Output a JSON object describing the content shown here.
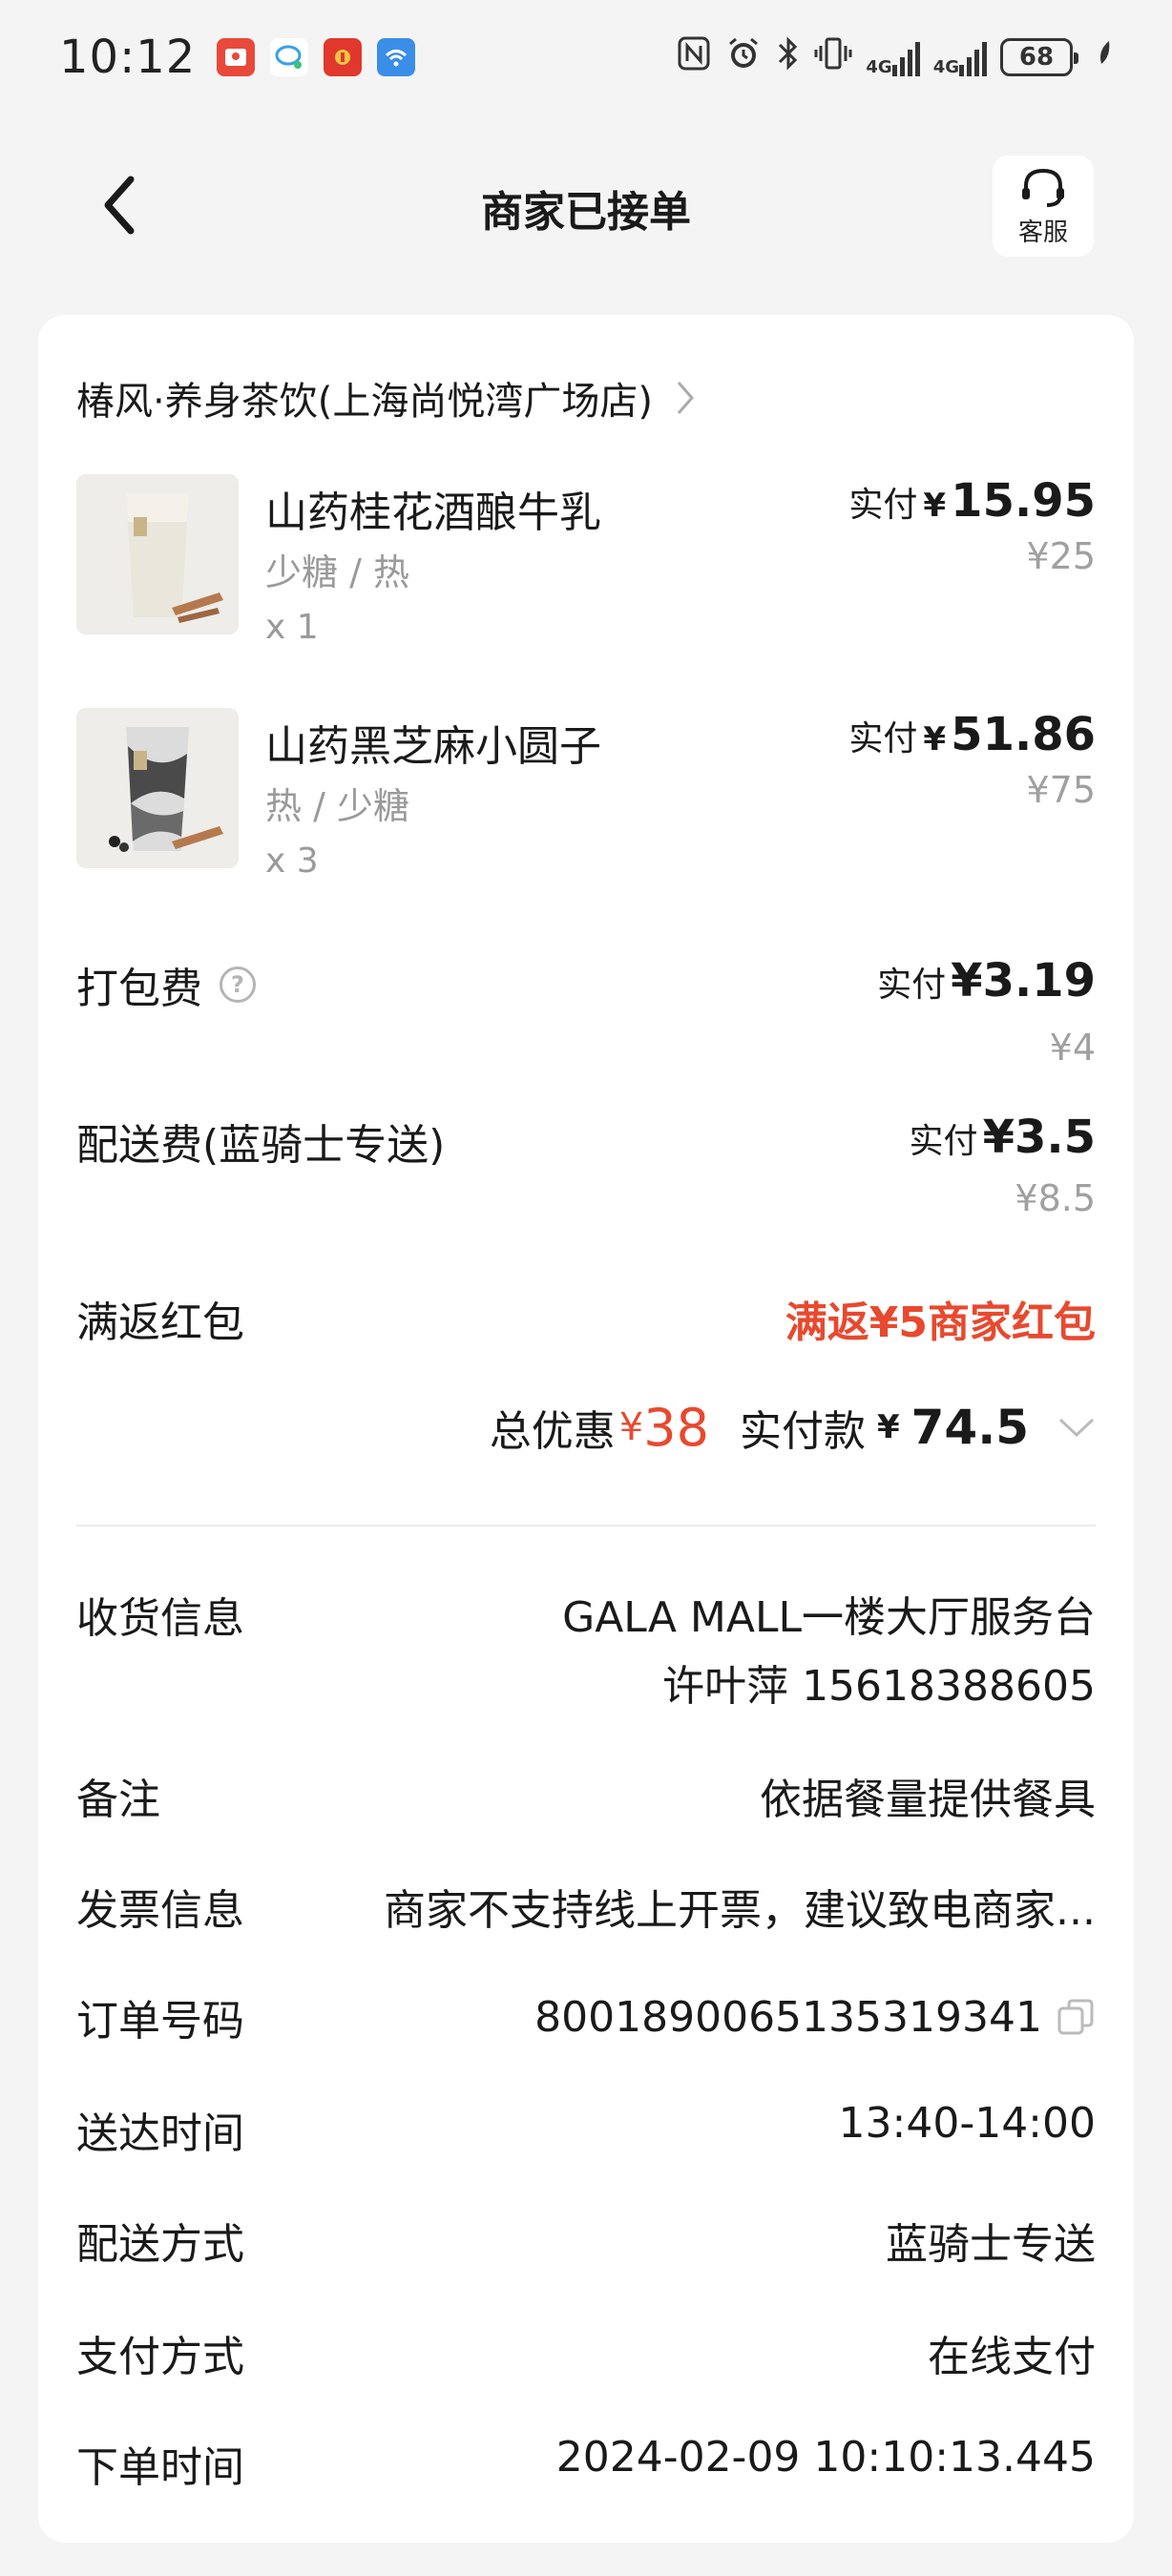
{
  "status_bar": {
    "time": "10:12",
    "network_1": "4G",
    "network_2": "4G",
    "battery": "68"
  },
  "header": {
    "title": "商家已接单",
    "service_label": "客服"
  },
  "store": {
    "name": "椿风·养身茶饮(上海尚悦湾广场店)"
  },
  "items": [
    {
      "name": "山药桂花酒酿牛乳",
      "spec": "少糖 / 热",
      "qty": "x 1",
      "paid_label": "实付",
      "paid_yen": "¥",
      "paid_value": "15.95",
      "original_price": "¥25"
    },
    {
      "name": "山药黑芝麻小圆子",
      "spec": "热 / 少糖",
      "qty": "x 3",
      "paid_label": "实付",
      "paid_yen": "¥",
      "paid_value": "51.86",
      "original_price": "¥75"
    }
  ],
  "fees": {
    "packing": {
      "label": "打包费",
      "paid_label": "实付",
      "paid_value": "¥3.19",
      "original": "¥4"
    },
    "delivery": {
      "label": "配送费(蓝骑士专送)",
      "paid_label": "实付",
      "paid_value": "¥3.5",
      "original": "¥8.5"
    }
  },
  "coupon": {
    "label": "满返红包",
    "value": "满返¥5商家红包"
  },
  "summary": {
    "discount_label": "总优惠",
    "discount_yen": "¥",
    "discount_value": "38",
    "pay_label": "实付款",
    "pay_yen": "¥",
    "pay_value": "74.5"
  },
  "order_info": {
    "receiver": {
      "label": "收货信息",
      "line1": "GALA MALL一楼大厅服务台",
      "line2": "许叶萍 15618388605"
    },
    "remark": {
      "label": "备注",
      "value": "依据餐量提供餐具"
    },
    "invoice": {
      "label": "发票信息",
      "value": "商家不支持线上开票，建议致电商家..."
    },
    "order_no": {
      "label": "订单号码",
      "value": "8001890065135319341"
    },
    "delivery_time": {
      "label": "送达时间",
      "value": "13:40-14:00"
    },
    "delivery_method": {
      "label": "配送方式",
      "value": "蓝骑士专送"
    },
    "payment_method": {
      "label": "支付方式",
      "value": "在线支付"
    },
    "order_time": {
      "label": "下单时间",
      "value": "2024-02-09 10:10:13.445"
    }
  },
  "colors": {
    "accent_red": "#e8492f",
    "page_bg": "#f4f4f4",
    "card_bg": "#ffffff",
    "muted_text": "#a0a0a0"
  }
}
